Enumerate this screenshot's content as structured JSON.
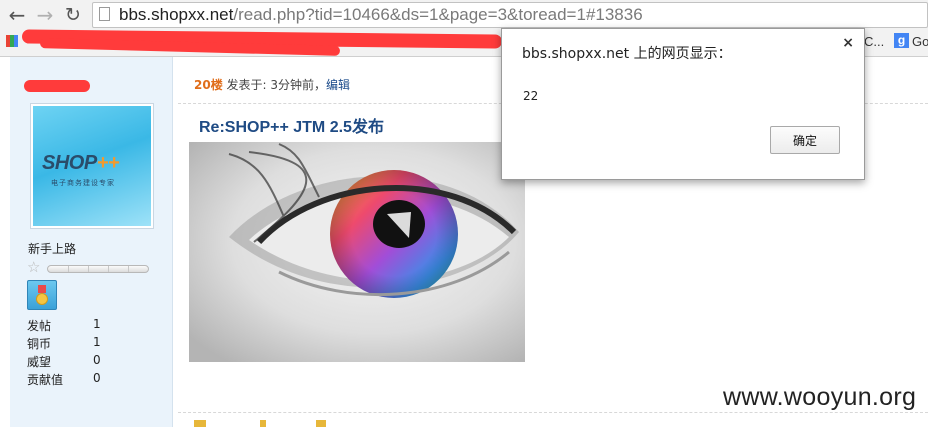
{
  "browser": {
    "url_host": "bbs.shopxx.net",
    "url_path": "/read.php?tid=10466&ds=1&page=3&toread=1#13836",
    "bookmark_tail_1": "C...",
    "bookmark_tail_2": "Go",
    "g_letter": "g",
    "icons": [
      "back-arrow-icon",
      "forward-arrow-icon",
      "reload-icon",
      "page-icon",
      "apps-icon"
    ]
  },
  "profile": {
    "rank": "新手上路",
    "stats": [
      {
        "label": "发帖",
        "value": "1"
      },
      {
        "label": "铜币",
        "value": "1"
      },
      {
        "label": "威望",
        "value": "0"
      },
      {
        "label": "贡献值",
        "value": "0"
      }
    ],
    "avatar": {
      "brand": "SHOP",
      "brand_plus": "++",
      "tagline": "电子商务建设专家"
    }
  },
  "post": {
    "floor": "20楼",
    "meta": "发表于: 3分钟前，",
    "edit": "编辑",
    "title": "Re:SHOP++ JTM 2.5发布"
  },
  "dialog": {
    "title": "bbs.shopxx.net 上的网页显示：",
    "message": "22",
    "ok": "确定",
    "close": "×"
  },
  "watermark": "www.wooyun.org",
  "colors": {
    "link": "#1f4b84",
    "floor": "#e06d1a",
    "redaction": "#ff3b3b"
  }
}
